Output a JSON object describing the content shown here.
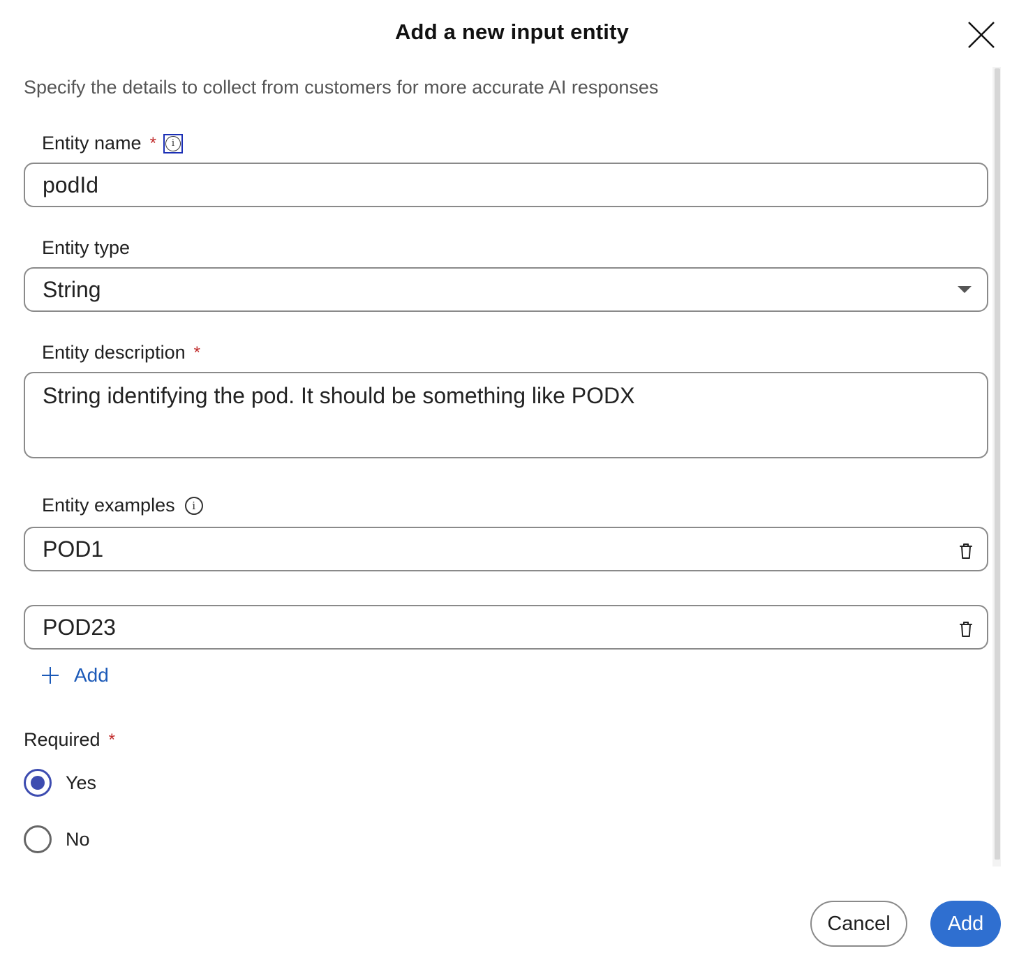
{
  "dialog": {
    "title": "Add a new input entity",
    "subtitle": "Specify the details to collect from customers for more accurate AI responses"
  },
  "entity_name": {
    "label": "Entity name",
    "required_mark": "*",
    "value": "podId"
  },
  "entity_type": {
    "label": "Entity type",
    "value": "String"
  },
  "entity_description": {
    "label": "Entity description",
    "required_mark": "*",
    "value": "String identifying the pod. It should be something like PODX"
  },
  "entity_examples": {
    "label": "Entity examples",
    "items": [
      "POD1",
      "POD23"
    ],
    "add_label": "Add"
  },
  "required": {
    "label": "Required",
    "required_mark": "*",
    "options": [
      {
        "label": "Yes",
        "selected": true
      },
      {
        "label": "No",
        "selected": false
      }
    ]
  },
  "footer": {
    "cancel_label": "Cancel",
    "add_label": "Add"
  },
  "colors": {
    "accent": "#2f6fd0",
    "radio_selected": "#3d4cb0",
    "required_mark": "#c02a2a",
    "link": "#1c5ab8"
  },
  "icons": [
    "close-icon",
    "info-icon",
    "chevron-down-icon",
    "trash-icon",
    "plus-icon"
  ]
}
